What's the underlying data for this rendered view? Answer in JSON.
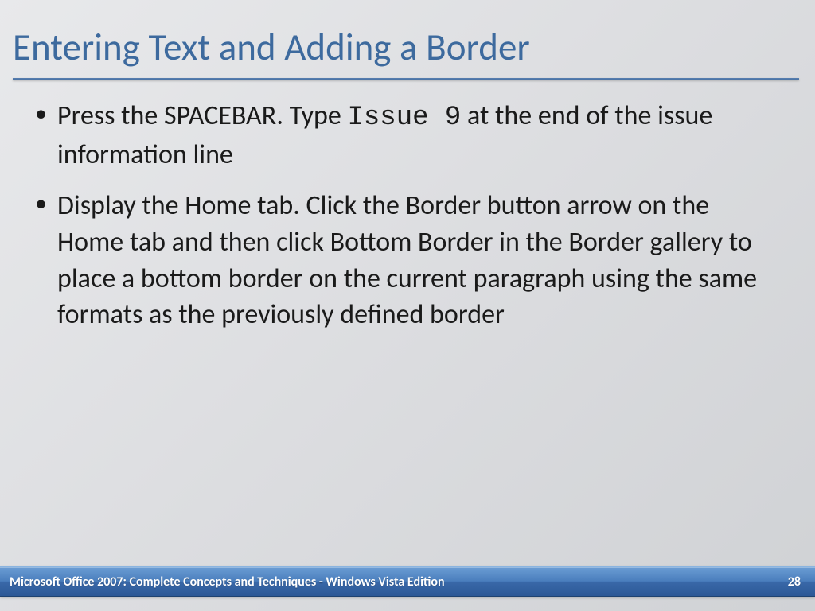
{
  "slide": {
    "title": "Entering Text and Adding a Border",
    "bullets": [
      {
        "prefix": "Press the SPACEBAR. Type ",
        "mono": "Issue 9",
        "suffix": " at the end of the issue information line"
      },
      {
        "prefix": " Display the Home tab. Click the Border button arrow on the Home tab and then click Bottom Border in the Border gallery to place a bottom border on the current paragraph using the same formats as the previously defined border",
        "mono": "",
        "suffix": ""
      }
    ]
  },
  "footer": {
    "text": "Microsoft Office 2007: Complete Concepts and Techniques - Windows Vista Edition",
    "page": "28"
  }
}
